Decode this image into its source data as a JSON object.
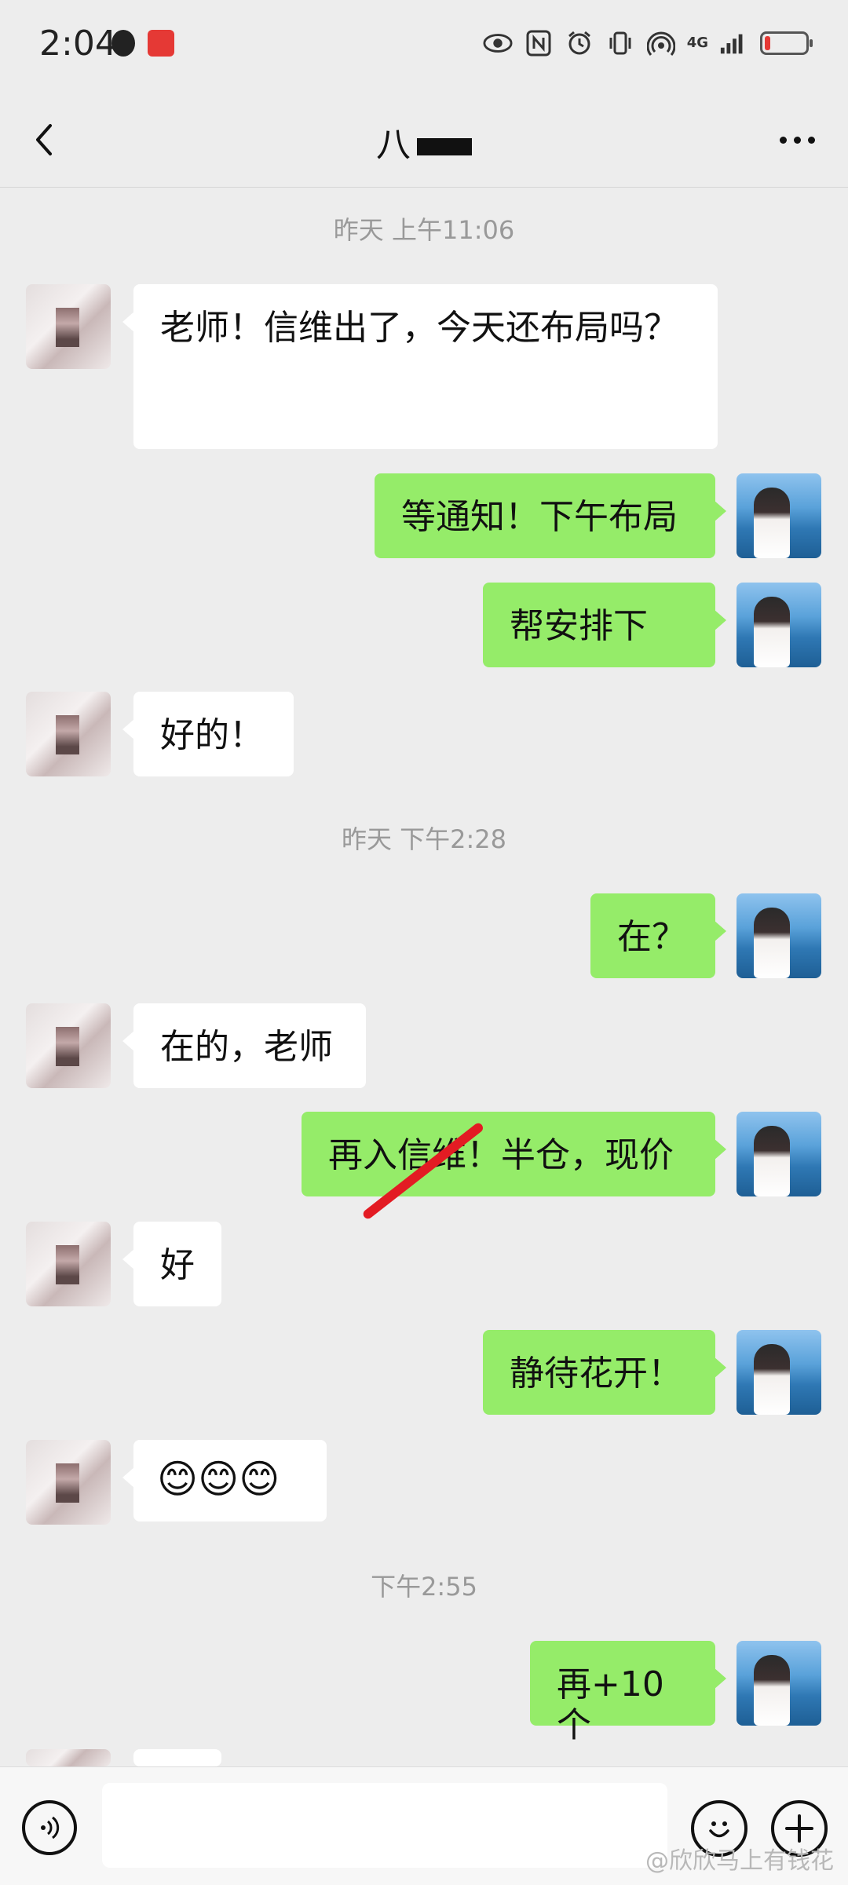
{
  "status_bar": {
    "time": "2:04",
    "network": "4G",
    "battery_level": 0.12,
    "battery_color": "#e53935",
    "icons": [
      "qq-icon",
      "app-icon",
      "eye-icon",
      "nfc-icon",
      "alarm-icon",
      "vibrate-icon",
      "hotspot-icon",
      "signal-icon",
      "battery-icon"
    ]
  },
  "nav": {
    "title": "八",
    "more_icon": "more-dots-icon",
    "back_icon": "back-chevron-icon"
  },
  "timestamps": {
    "t1": "昨天 上午11:06",
    "t2": "昨天 下午2:28",
    "t3": "下午2:55"
  },
  "messages": {
    "m1": "老师！信维出了，今天还布局吗？",
    "m2": "等通知！下午布局",
    "m3": "帮安排下",
    "m4": "好的！",
    "m5": "在？",
    "m6": "在的，老师",
    "m7": "再入信维！半仓，现价",
    "m8": "好",
    "m9": "静待花开！",
    "m10": "😊😊😊",
    "m11": "再+10个"
  },
  "input": {
    "voice_icon": "voice-icon",
    "emoji_icon": "emoji-icon",
    "plus_icon": "plus-icon"
  },
  "watermark": "@欣欣马上有钱花",
  "colors": {
    "background": "#ededed",
    "outgoing_bubble": "#95ec69",
    "incoming_bubble": "#ffffff",
    "annotation_red": "#e31b23"
  }
}
